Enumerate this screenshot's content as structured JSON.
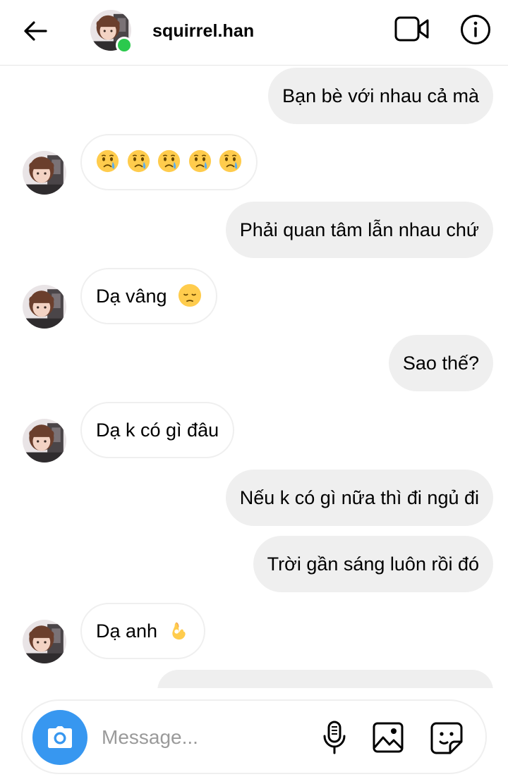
{
  "header": {
    "username": "squirrel.han",
    "online": true
  },
  "messages": [
    {
      "side": "out",
      "text": "Bạn bè với nhau cả mà"
    },
    {
      "side": "in",
      "text": "",
      "emoji": [
        "crying-face",
        "crying-face",
        "crying-face",
        "crying-face",
        "crying-face"
      ]
    },
    {
      "side": "out",
      "text": "Phải quan tâm lẫn nhau chứ"
    },
    {
      "side": "in",
      "text": "Dạ vâng",
      "emoji": [
        "pensive-face"
      ]
    },
    {
      "side": "out",
      "text": "Sao thế?"
    },
    {
      "side": "in",
      "text": "Dạ k có gì đâu"
    },
    {
      "side": "out",
      "text": "Nếu k có gì nữa thì đi ngủ đi"
    },
    {
      "side": "out",
      "text": "Trời gần sáng luôn rồi đó"
    },
    {
      "side": "in",
      "text": "Dạ anh",
      "emoji": [
        "ok-hand"
      ]
    }
  ],
  "composer": {
    "placeholder": "Message..."
  },
  "icons": {
    "back": "arrow-left-icon",
    "video": "video-camera-icon",
    "info": "info-icon",
    "camera": "camera-icon",
    "mic": "microphone-icon",
    "gallery": "image-icon",
    "sticker": "sticker-icon"
  },
  "colors": {
    "accent": "#3797f0",
    "online": "#2bc94d",
    "bubble_out": "#efefef",
    "bubble_in_border": "#efefef"
  }
}
